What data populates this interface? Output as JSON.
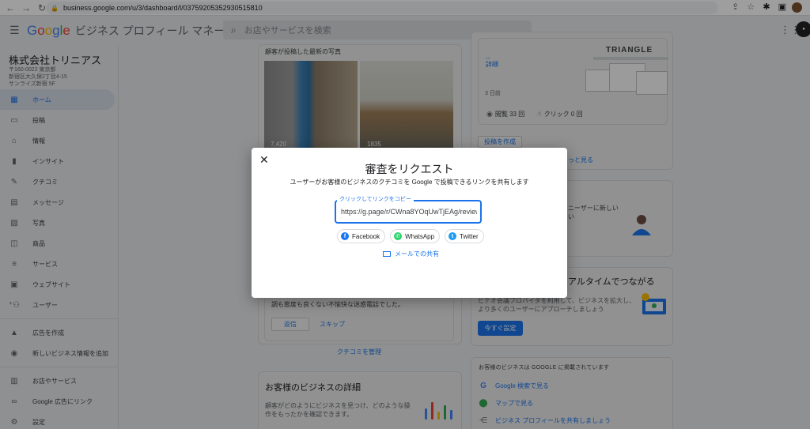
{
  "browser": {
    "url": "business.google.com/u/3/dashboard/l/03759205352930515810"
  },
  "header": {
    "logo_google": [
      "G",
      "o",
      "o",
      "g",
      "l",
      "e"
    ],
    "product": "ビジネス プロフィール マネージャ",
    "search_placeholder": "お店やサービスを検索"
  },
  "sidebar": {
    "business_name": "株式会社トリニアス",
    "address": "〒160-0022 東京都\n新宿区大久保2丁目4-15\nサンライズ新宿 5F",
    "items": [
      {
        "label": "ホーム",
        "icon": "dashboard-icon"
      },
      {
        "label": "投稿",
        "icon": "post-icon"
      },
      {
        "label": "情報",
        "icon": "store-icon"
      },
      {
        "label": "インサイト",
        "icon": "insights-icon"
      },
      {
        "label": "クチコミ",
        "icon": "reviews-icon"
      },
      {
        "label": "メッセージ",
        "icon": "message-icon"
      },
      {
        "label": "写真",
        "icon": "photos-icon"
      },
      {
        "label": "商品",
        "icon": "products-icon"
      },
      {
        "label": "サービス",
        "icon": "services-icon"
      },
      {
        "label": "ウェブサイト",
        "icon": "website-icon"
      },
      {
        "label": "ユーザー",
        "icon": "add-user-icon"
      }
    ],
    "items2": [
      {
        "label": "広告を作成",
        "icon": "ads-icon"
      },
      {
        "label": "新しいビジネス情報を追加",
        "icon": "location-icon"
      }
    ],
    "items3": [
      {
        "label": "お店やサービス",
        "icon": "storefront-icon"
      },
      {
        "label": "Google 広告にリンク",
        "icon": "link-icon"
      },
      {
        "label": "設定",
        "icon": "gear-icon"
      }
    ]
  },
  "main": {
    "photos_label": "顧客が投稿した最新の写真",
    "photo1_count": "7,420",
    "photo2_count": "1835",
    "review_excerpt": "調も態度も良くない不愉快な迷惑電話でした。",
    "reply_label": "返信",
    "skip_label": "スキップ",
    "manage_reviews": "クチコミを管理",
    "details_title": "お客様のビジネスの詳細",
    "details_text": "顧客がどのようにビジネスを見つけ、どのような操作をもったかを確認できます。",
    "post_dash": "--",
    "post_detail": "詳細",
    "post_days": "3 日前",
    "triangle_logo": "TRIANGLE",
    "views_label": "閲覧 33 回",
    "clicks_label": "クリック 0 回",
    "create_post": "投稿を作成",
    "see_more": "っと見る",
    "new_users": "ニーザーに新しい\nい",
    "realtime_title": "アルタイムでつながる",
    "realtime_text": "ビデオ会議プロバイダを利用して、ビジネスを拡大し、より多くのユーザーにアプローチしましょう",
    "set_now": "今すぐ設定",
    "connected_title": "お客様のビジネスは GOOGLE に掲載されています",
    "links": [
      {
        "label": "Google 検索で見る",
        "icon": "google-icon"
      },
      {
        "label": "マップで見る",
        "icon": "maps-pin-icon"
      },
      {
        "label": "ビジネス プロフィールを共有しましょう",
        "icon": "share-icon"
      }
    ]
  },
  "modal": {
    "title": "審査をリクエスト",
    "subtitle": "ユーザーがお客様のビジネスのクチコミを Google で投稿できるリンクを共有します",
    "field_label": "クリックしてリンクをコピー",
    "link_value": "https://g.page/r/CWna8YOqUwTjEAg/review",
    "share_buttons": [
      {
        "label": "Facebook",
        "glyph": "f"
      },
      {
        "label": "WhatsApp",
        "glyph": "✆"
      },
      {
        "label": "Twitter",
        "glyph": "t"
      }
    ],
    "email_share": "メールでの共有"
  },
  "colors": {
    "accent": "#1a73e8",
    "facebook": "#1877f2",
    "whatsapp": "#25d366",
    "twitter": "#1d9bf0"
  }
}
